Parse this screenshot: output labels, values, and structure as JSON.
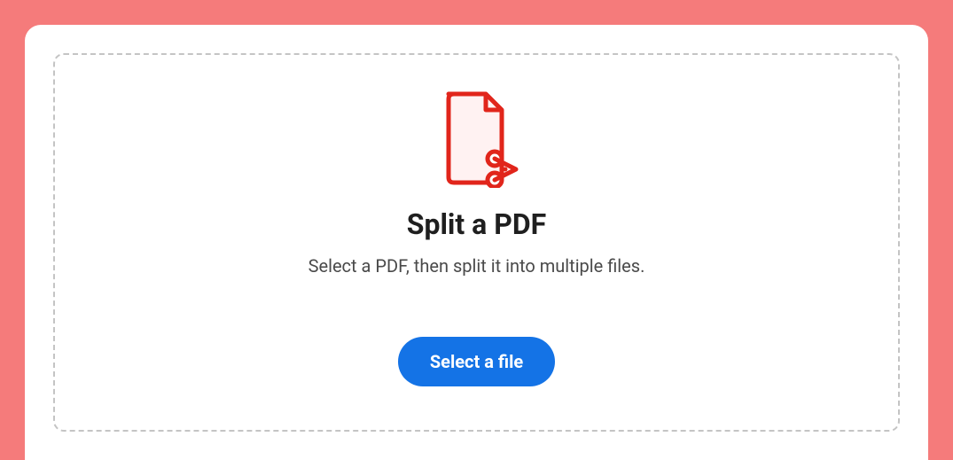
{
  "main": {
    "title": "Split a PDF",
    "subtitle": "Select a PDF, then split it into multiple files.",
    "select_button_label": "Select a file"
  },
  "colors": {
    "background": "#f57b7b",
    "card": "#ffffff",
    "accent": "#1473e6",
    "icon": "#e1251b",
    "icon_fill": "#fff2f2"
  }
}
